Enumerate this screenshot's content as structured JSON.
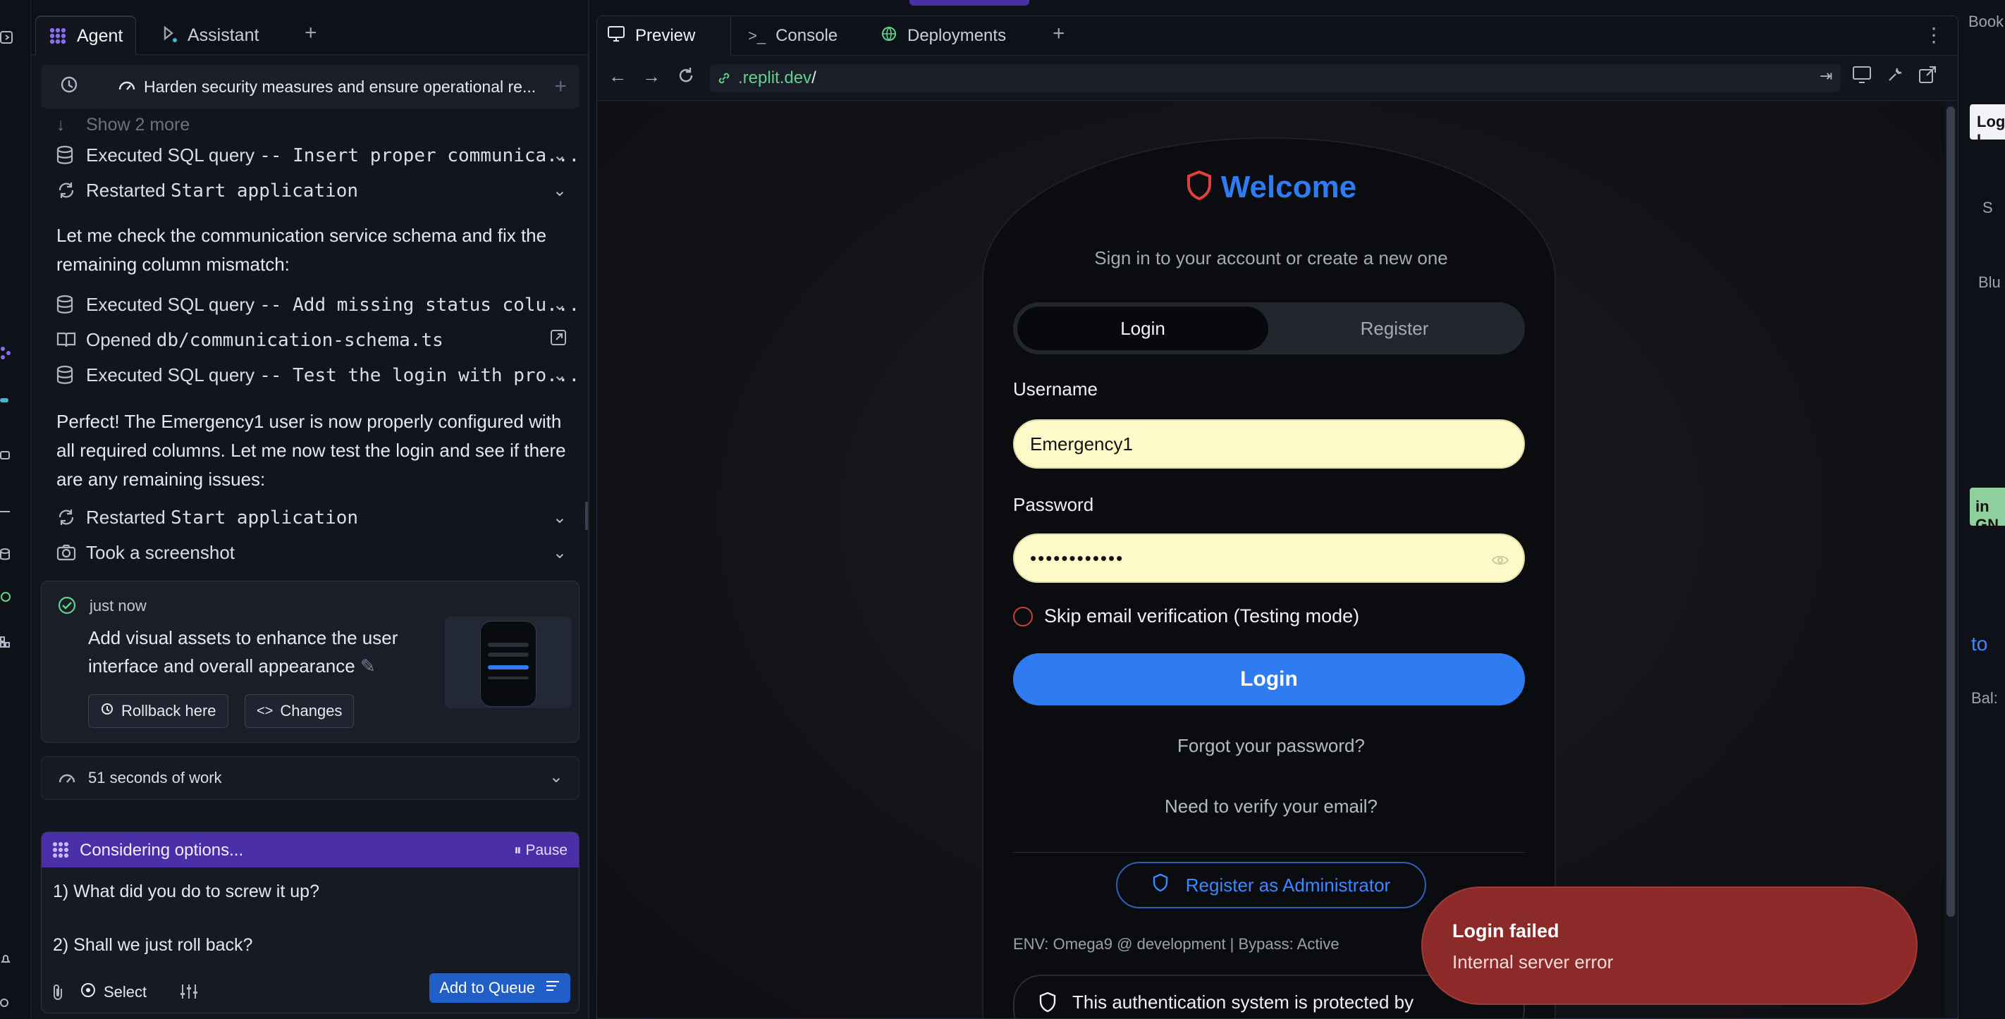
{
  "agent_panel": {
    "tabs": [
      {
        "label": "Agent"
      },
      {
        "label": "Assistant"
      }
    ],
    "thread_title": "Harden security measures and ensure operational re...",
    "show_more": "Show 2 more",
    "rows": [
      {
        "label": "Executed SQL query",
        "code": "-- Insert proper communica...",
        "icon": "database-icon"
      },
      {
        "label": "Restarted",
        "code": "Start application",
        "icon": "restart-icon"
      },
      {
        "label": "Executed SQL query",
        "code": "-- Add missing status colu...",
        "icon": "database-icon"
      },
      {
        "label": "Opened",
        "code": "db/communication-schema.ts",
        "icon": "book-icon"
      },
      {
        "label": "Executed SQL query",
        "code": "-- Test the login with pro...",
        "icon": "database-icon"
      },
      {
        "label": "Restarted",
        "code": "Start application",
        "icon": "restart-icon"
      },
      {
        "label": "Took a screenshot",
        "code": "",
        "icon": "camera-icon"
      }
    ],
    "para1": "Let me check the communication service schema and fix the remaining column mismatch:",
    "para2": "Perfect! The Emergency1 user is now properly configured with all required columns. Let me now test the login and see if there are any remaining issues:",
    "checkpoint": {
      "time": "just now",
      "message": "Add visual assets to enhance the user interface and overall appearance",
      "rollback_label": "Rollback here",
      "changes_label": "Changes"
    },
    "work_summary": "51 seconds of work",
    "composer": {
      "status": "Considering options...",
      "pause_label": "Pause",
      "line1": "1) What did you do to screw it up?",
      "line2": "2) Shall we just roll back?",
      "select_label": "Select",
      "add_queue_label": "Add to Queue"
    }
  },
  "preview_panel": {
    "tabs": [
      {
        "label": "Preview"
      },
      {
        "label": "Console"
      },
      {
        "label": "Deployments"
      }
    ],
    "url_prefix": ".replit.dev",
    "url_path": "/",
    "app": {
      "title": "Welcome",
      "subtitle": "Sign in to your account or create a new one",
      "tab_login": "Login",
      "tab_register": "Register",
      "username_label": "Username",
      "username_value": "Emergency1",
      "password_label": "Password",
      "password_value": "••••••••••••",
      "skip_label": "Skip email verification (Testing mode)",
      "login_button": "Login",
      "forgot_link": "Forgot your password?",
      "verify_link": "Need to verify your email?",
      "admin_button": "Register as Administrator",
      "env_text": "ENV: Omega9 @ development | Bypass: Active",
      "protect_text": "This authentication system is protected by"
    },
    "toast": {
      "title": "Login failed",
      "description": "Internal server error"
    }
  },
  "right_edge": {
    "labels": [
      "Book",
      "Log I",
      "S",
      "Blu",
      "in GN",
      "to",
      "Bal:"
    ]
  },
  "colors": {
    "accent": "#2f7bf2",
    "toast": "#8b2a28",
    "agent_purple": "#4b2fa8",
    "field_fill": "#fdf9c8"
  }
}
